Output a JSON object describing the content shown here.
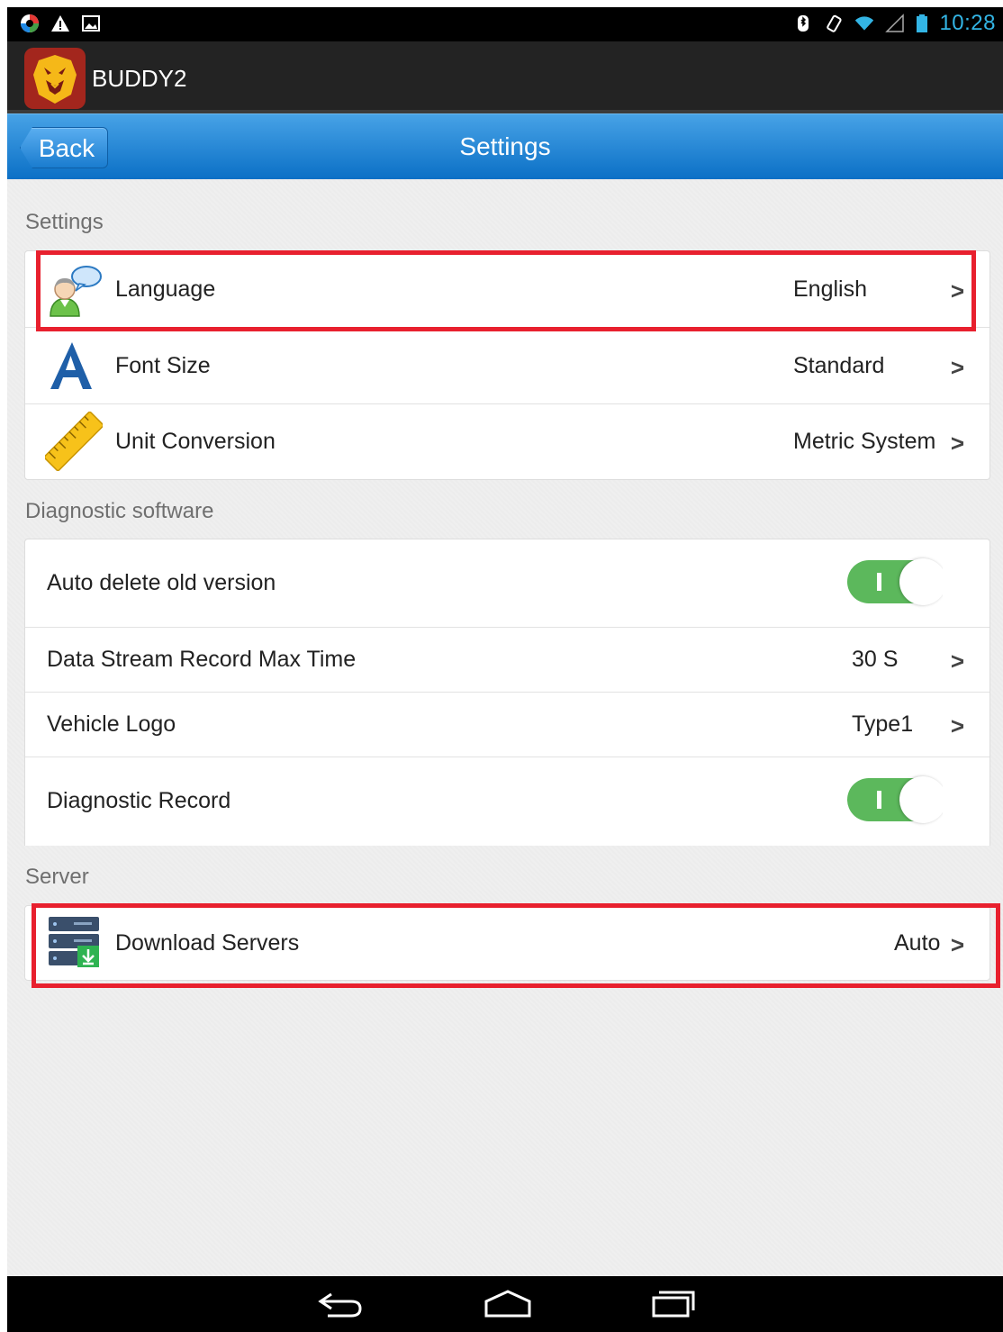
{
  "status_bar": {
    "left_icons": [
      "app-notification-icon",
      "warning-icon",
      "image-icon"
    ],
    "right_icons": [
      "bluetooth-icon",
      "rotation-icon",
      "wifi-icon",
      "signal-icon",
      "battery-icon"
    ],
    "time": "10:28"
  },
  "app_bar": {
    "title": "BUDDY2",
    "logo_icon": "lion-logo-icon"
  },
  "header": {
    "back_label": "Back",
    "title": "Settings"
  },
  "sections": {
    "settings": {
      "label": "Settings",
      "rows": [
        {
          "label": "Language",
          "value": "English",
          "icon": "language-person-icon"
        },
        {
          "label": "Font Size",
          "value": "Standard",
          "icon": "font-a-icon"
        },
        {
          "label": "Unit Conversion",
          "value": "Metric System",
          "icon": "ruler-icon"
        }
      ]
    },
    "diagnostic": {
      "label": "Diagnostic software",
      "rows": [
        {
          "label": "Auto delete old version",
          "toggle": true
        },
        {
          "label": "Data Stream Record Max Time",
          "value": "30 S"
        },
        {
          "label": "Vehicle Logo",
          "value": "Type1"
        },
        {
          "label": "Diagnostic Record",
          "toggle": true
        }
      ]
    },
    "server": {
      "label": "Server",
      "rows": [
        {
          "label": "Download Servers",
          "value": "Auto",
          "icon": "server-download-icon"
        }
      ]
    }
  },
  "chevron": ">",
  "navbar": {
    "icons": [
      "back-nav-icon",
      "home-nav-icon",
      "recent-apps-icon"
    ]
  },
  "colors": {
    "header_blue": "#0b70c6",
    "toggle_on": "#5cb85c",
    "highlight_red": "#e8202e",
    "status_accent": "#33b5e5"
  }
}
